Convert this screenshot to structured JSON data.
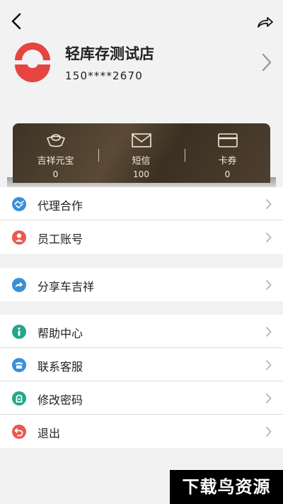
{
  "header": {
    "back_icon": "back-arrow-icon",
    "share_icon": "share-icon"
  },
  "profile": {
    "store_name": "轻库存测试店",
    "phone": "150****2670",
    "logo_color": "#e64440"
  },
  "card": {
    "items": [
      {
        "label": "吉祥元宝",
        "value": "0",
        "icon": "ingot-icon"
      },
      {
        "label": "短信",
        "value": "100",
        "icon": "envelope-icon"
      },
      {
        "label": "卡券",
        "value": "0",
        "icon": "card-icon"
      }
    ]
  },
  "menu": {
    "group1": [
      {
        "label": "代理合作",
        "icon": "handshake-icon",
        "color": "#3a8fd8"
      },
      {
        "label": "员工账号",
        "icon": "person-icon",
        "color": "#e85a4f"
      }
    ],
    "group2": [
      {
        "label": "分享车吉祥",
        "icon": "share-icon",
        "color": "#3a8fd8"
      }
    ],
    "group3": [
      {
        "label": "帮助中心",
        "icon": "info-icon",
        "color": "#25a78c"
      },
      {
        "label": "联系客服",
        "icon": "phone-icon",
        "color": "#3a8fd8"
      },
      {
        "label": "修改密码",
        "icon": "lock-icon",
        "color": "#25a78c"
      },
      {
        "label": "退出",
        "icon": "logout-icon",
        "color": "#e85a4f"
      }
    ]
  },
  "watermark": {
    "text": "下载鸟资源"
  }
}
